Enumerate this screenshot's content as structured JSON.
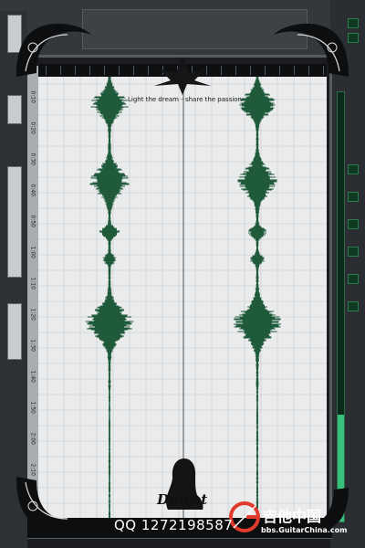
{
  "watermark": {
    "slogan": "Light the dream - share the passion",
    "contact": "QQ 1272198587",
    "signature": "Dulcet",
    "site_name": "吉他中国",
    "site_url": "bbs.GuitarChina.com"
  },
  "ruler": {
    "labels": [
      "0:10",
      "0:20",
      "0:30",
      "0:40",
      "0:50",
      "1:00",
      "1:10",
      "1:20",
      "1:30",
      "1:40",
      "1:50",
      "2:00",
      "2:10"
    ]
  },
  "meter": {
    "level": 0.25
  },
  "colors": {
    "background": "#e9ebec",
    "grid": "#c3c7cb",
    "waveform": "#1f5a3a",
    "cursor": "#6a6d70",
    "frame": "#585c61",
    "meter": "#36c17a"
  },
  "icons": [
    "corner-ornament-icon",
    "top-crest-icon",
    "guitarchina-logo-icon",
    "silhouette-icon"
  ]
}
